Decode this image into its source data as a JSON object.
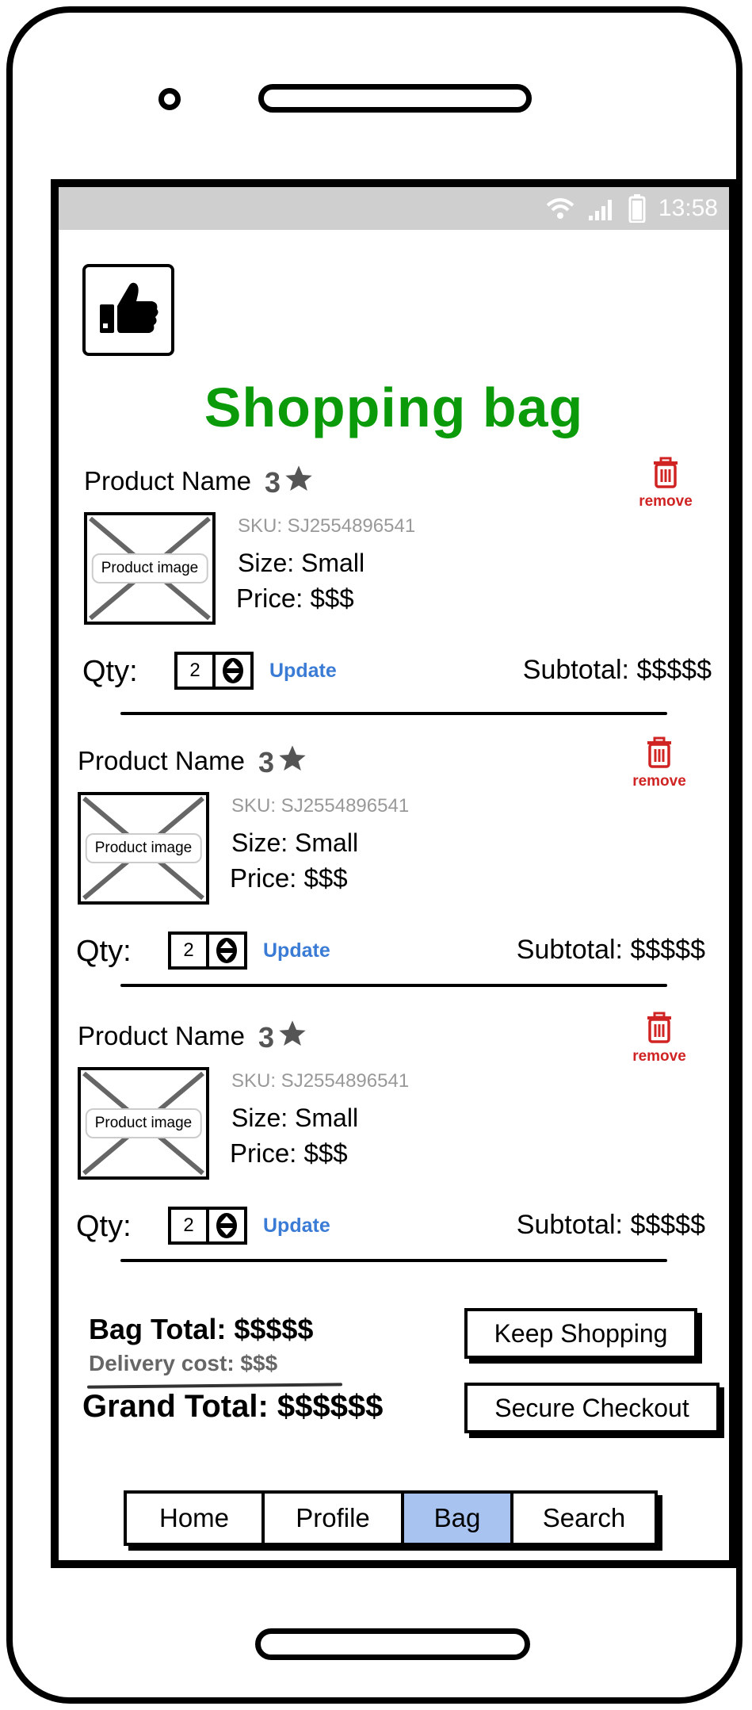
{
  "status_bar": {
    "time": "13:58"
  },
  "page": {
    "title": "Shopping bag"
  },
  "items": [
    {
      "name": "Product Name",
      "rating": "3",
      "remove_label": "remove",
      "image_label": "Product image",
      "sku": "SJ2554896541",
      "sku_text": "SKU: SJ2554896541",
      "size_text": "Size: Small",
      "price_text": "Price: $$$",
      "qty_label": "Qty:",
      "qty_value": "2",
      "update_label": "Update",
      "subtotal_text": "Subtotal: $$$$$"
    },
    {
      "name": "Product Name",
      "rating": "3",
      "remove_label": "remove",
      "image_label": "Product image",
      "sku": "SJ2554896541",
      "sku_text": "SKU: SJ2554896541",
      "size_text": "Size: Small",
      "price_text": "Price: $$$",
      "qty_label": "Qty:",
      "qty_value": "2",
      "update_label": "Update",
      "subtotal_text": "Subtotal: $$$$$"
    },
    {
      "name": "Product Name",
      "rating": "3",
      "remove_label": "remove",
      "image_label": "Product image",
      "sku": "SJ2554896541",
      "sku_text": "SKU: SJ2554896541",
      "size_text": "Size: Small",
      "price_text": "Price: $$$",
      "qty_label": "Qty:",
      "qty_value": "2",
      "update_label": "Update",
      "subtotal_text": "Subtotal: $$$$$"
    }
  ],
  "totals": {
    "bag_total": "Bag Total: $$$$$",
    "delivery_cost": "Delivery cost: $$$",
    "grand_total": "Grand Total: $$$$$$"
  },
  "actions": {
    "keep_shopping": "Keep Shopping",
    "secure_checkout": "Secure Checkout"
  },
  "nav": {
    "tabs": [
      {
        "label": "Home",
        "active": false
      },
      {
        "label": "Profile",
        "active": false
      },
      {
        "label": "Bag",
        "active": true
      },
      {
        "label": "Search",
        "active": false
      }
    ]
  },
  "colors": {
    "title_green": "#0a9a0a",
    "remove_red": "#d02424",
    "update_blue": "#3a7bd5",
    "active_tab": "#a8c3f0",
    "status_bar": "#cfcfcf"
  },
  "icons": [
    "wifi-icon",
    "signal-icon",
    "battery-icon",
    "thumbs-up-icon",
    "star-icon",
    "trash-icon",
    "up-down-arrows-icon"
  ]
}
